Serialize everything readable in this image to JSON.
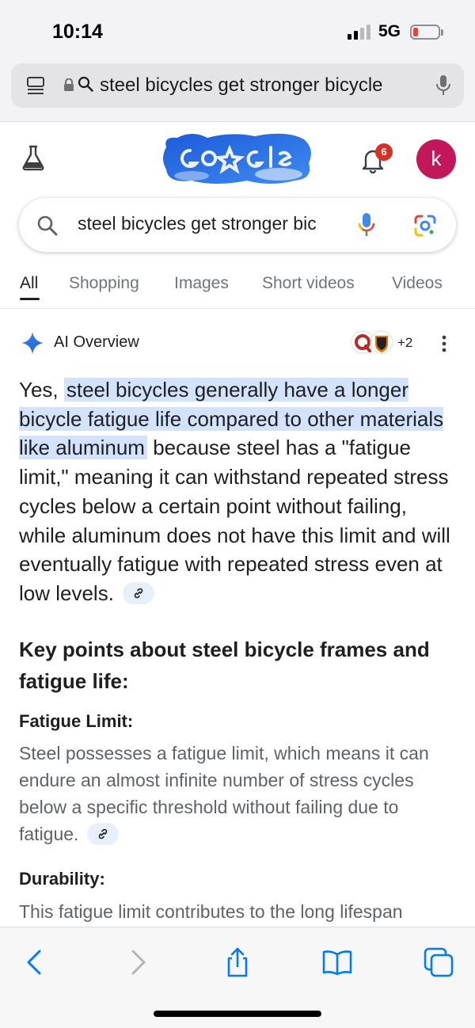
{
  "status_bar": {
    "time": "10:14",
    "network": "5G"
  },
  "browser": {
    "url_text": "steel bicycles get stronger bicycle"
  },
  "header": {
    "notification_count": "6",
    "avatar_letter": "k"
  },
  "search": {
    "query": "steel bicycles get stronger bic"
  },
  "tabs": [
    {
      "label": "All",
      "active": true
    },
    {
      "label": "Shopping"
    },
    {
      "label": "Images"
    },
    {
      "label": "Short videos"
    },
    {
      "label": "Videos"
    }
  ],
  "ai_overview": {
    "title": "AI Overview",
    "sources_more": "+2",
    "answer_prefix": "Yes,",
    "answer_highlight": "steel bicycles generally have a longer bicycle fatigue life compared to other materials like aluminum",
    "answer_rest": "because steel has a \"fatigue limit,\" meaning it can withstand repeated stress cycles below a certain point without failing, while aluminum does not have this limit and will eventually fatigue with repeated stress even at low levels.",
    "key_points_heading": "Key points about steel bicycle frames and fatigue life:",
    "points": [
      {
        "heading": "Fatigue Limit:",
        "text": "Steel possesses a fatigue limit, which means it can endure an almost infinite number of stress cycles below a specific threshold without failing due to fatigue."
      },
      {
        "heading": "Durability:",
        "text": "This fatigue limit contributes to the long lifespan"
      }
    ]
  },
  "colors": {
    "accent_blue": "#1a73e8",
    "highlight": "#d3e3fd",
    "badge_red": "#d93025",
    "avatar": "#c2185b",
    "safari_blue": "#007aff"
  }
}
